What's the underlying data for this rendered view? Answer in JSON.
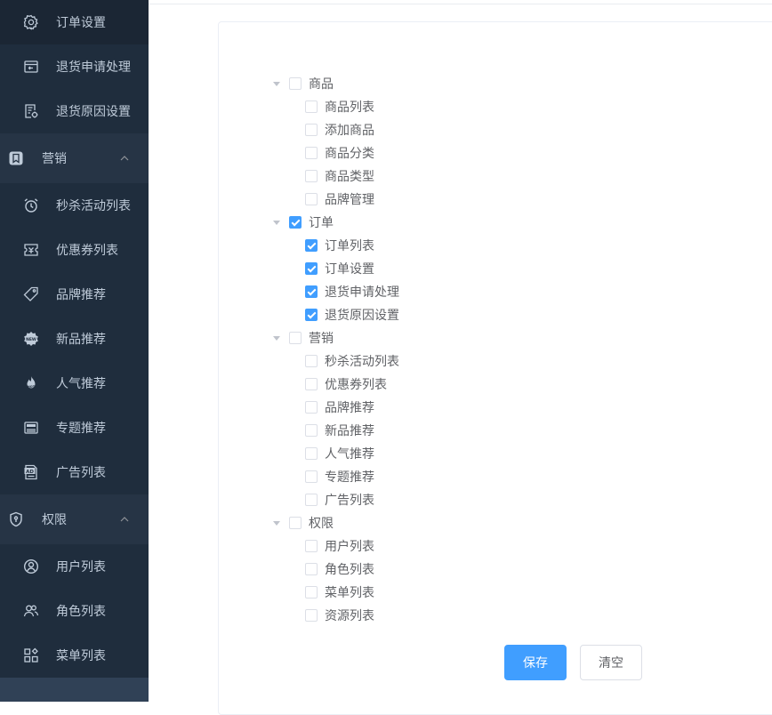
{
  "sidebar": {
    "order_items": [
      {
        "label": "订单设置",
        "icon": "gear-icon",
        "active": true
      },
      {
        "label": "退货申请处理",
        "icon": "return-box-icon"
      },
      {
        "label": "退货原因设置",
        "icon": "document-settings-icon"
      }
    ],
    "marketing": {
      "label": "营销",
      "icon": "bookmark-icon",
      "items": [
        {
          "label": "秒杀活动列表",
          "icon": "alarm-clock-icon"
        },
        {
          "label": "优惠券列表",
          "icon": "ticket-icon"
        },
        {
          "label": "品牌推荐",
          "icon": "tag-icon"
        },
        {
          "label": "新品推荐",
          "icon": "new-badge-icon"
        },
        {
          "label": "人气推荐",
          "icon": "flame-icon"
        },
        {
          "label": "专题推荐",
          "icon": "topic-icon"
        },
        {
          "label": "广告列表",
          "icon": "ad-icon"
        }
      ]
    },
    "permission": {
      "label": "权限",
      "icon": "shield-icon",
      "items": [
        {
          "label": "用户列表",
          "icon": "user-circle-icon"
        },
        {
          "label": "角色列表",
          "icon": "users-icon"
        },
        {
          "label": "菜单列表",
          "icon": "grid-menu-icon"
        }
      ]
    }
  },
  "tree": [
    {
      "label": "商品",
      "checked": false,
      "children": [
        {
          "label": "商品列表",
          "checked": false
        },
        {
          "label": "添加商品",
          "checked": false
        },
        {
          "label": "商品分类",
          "checked": false
        },
        {
          "label": "商品类型",
          "checked": false
        },
        {
          "label": "品牌管理",
          "checked": false
        }
      ]
    },
    {
      "label": "订单",
      "checked": true,
      "children": [
        {
          "label": "订单列表",
          "checked": true
        },
        {
          "label": "订单设置",
          "checked": true
        },
        {
          "label": "退货申请处理",
          "checked": true
        },
        {
          "label": "退货原因设置",
          "checked": true
        }
      ]
    },
    {
      "label": "营销",
      "checked": false,
      "children": [
        {
          "label": "秒杀活动列表",
          "checked": false
        },
        {
          "label": "优惠券列表",
          "checked": false
        },
        {
          "label": "品牌推荐",
          "checked": false
        },
        {
          "label": "新品推荐",
          "checked": false
        },
        {
          "label": "人气推荐",
          "checked": false
        },
        {
          "label": "专题推荐",
          "checked": false
        },
        {
          "label": "广告列表",
          "checked": false
        }
      ]
    },
    {
      "label": "权限",
      "checked": false,
      "children": [
        {
          "label": "用户列表",
          "checked": false
        },
        {
          "label": "角色列表",
          "checked": false
        },
        {
          "label": "菜单列表",
          "checked": false
        },
        {
          "label": "资源列表",
          "checked": false
        }
      ]
    }
  ],
  "buttons": {
    "save_label": "保存",
    "clear_label": "清空"
  },
  "colors": {
    "sidebar_bg": "#304156",
    "submenu_bg": "#1f2d3d",
    "accent": "#409eff",
    "sidebar_text": "#bfcbd9"
  }
}
